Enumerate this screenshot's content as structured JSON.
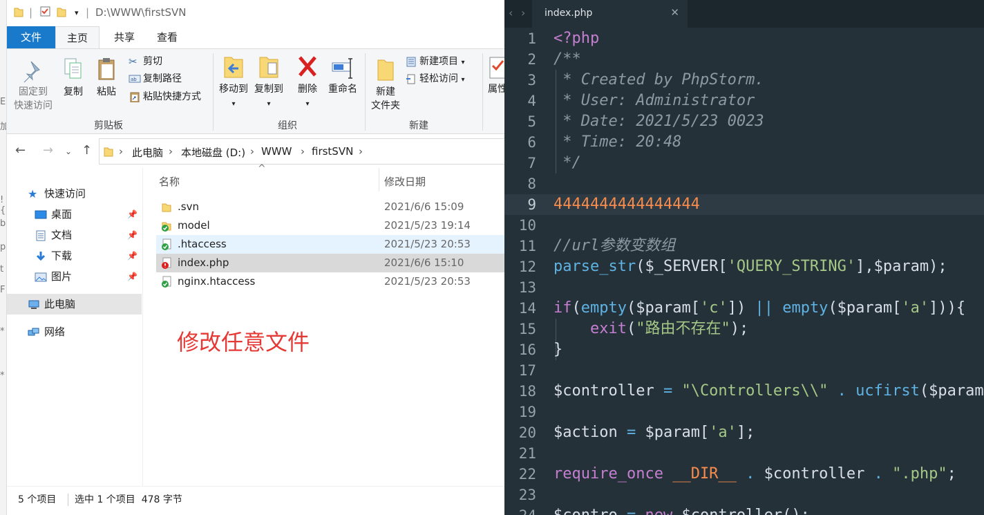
{
  "explorer": {
    "title_path": "D:\\WWW\\firstSVN",
    "tabs": [
      {
        "label": "文件"
      },
      {
        "label": "主页"
      },
      {
        "label": "共享"
      },
      {
        "label": "查看"
      }
    ],
    "ribbon": {
      "pin_line1": "固定到",
      "pin_line2": "快速访问",
      "copy": "复制",
      "paste": "粘贴",
      "cut": "剪切",
      "copy_path": "复制路径",
      "paste_shortcut": "粘贴快捷方式",
      "clipboard_group": "剪贴板",
      "move_to": "移动到",
      "copy_to": "复制到",
      "delete": "删除",
      "rename": "重命名",
      "organize_group": "组织",
      "new_folder_line1": "新建",
      "new_folder_line2": "文件夹",
      "new_item": "新建项目",
      "easy_access": "轻松访问",
      "new_group": "新建",
      "properties": "属性"
    },
    "breadcrumbs": [
      "此电脑",
      "本地磁盘 (D:)",
      "WWW",
      "firstSVN"
    ],
    "sidebar": {
      "quick_access": "快速访问",
      "items": [
        {
          "label": "桌面"
        },
        {
          "label": "文档"
        },
        {
          "label": "下载"
        },
        {
          "label": "图片"
        }
      ],
      "this_pc": "此电脑",
      "network": "网络"
    },
    "columns": {
      "name": "名称",
      "date": "修改日期"
    },
    "files": [
      {
        "name": ".svn",
        "date": "2021/6/6 15:09",
        "icon": "folder-icon"
      },
      {
        "name": "model",
        "date": "2021/5/23 19:14",
        "icon": "svn-normal-folder-icon"
      },
      {
        "name": ".htaccess",
        "date": "2021/5/23 20:53",
        "icon": "svn-normal-file-icon"
      },
      {
        "name": "index.php",
        "date": "2021/6/6 15:10",
        "icon": "svn-modified-file-icon"
      },
      {
        "name": "nginx.htaccess",
        "date": "2021/5/23 20:53",
        "icon": "svn-normal-file-icon"
      }
    ],
    "annotation": "修改任意文件",
    "status": {
      "count": "5 个项目",
      "selection": "选中 1 个项目  478 字节"
    },
    "colors": {
      "file_tab": "#1979ca",
      "annotation": "#e53935",
      "selected_row": "#d9d9d9",
      "hover_row": "#e5f3ff"
    }
  },
  "editor": {
    "tab_label": "index.php",
    "close_glyph": "✕",
    "current_line": "9",
    "line_numbers": [
      "1",
      "2",
      "3",
      "4",
      "5",
      "6",
      "7",
      "8",
      "9",
      "10",
      "11",
      "12",
      "13",
      "14",
      "15",
      "16",
      "17",
      "18",
      "19",
      "20",
      "21",
      "22",
      "23",
      "24"
    ],
    "code": {
      "l1": "<?php",
      "l2": "/**",
      "l3": " * Created by PhpStorm.",
      "l4": " * User: Administrator",
      "l5": " * Date: 2021/5/23 0023",
      "l6": " * Time: 20:48",
      "l7": " */",
      "l9": "4444444444444444",
      "l11": "//url参数变数组",
      "l12a": "parse_str",
      "l12b": "($_SERVER[",
      "l12c": "'QUERY_STRING'",
      "l12d": "],$param);",
      "l14a": "if",
      "l14b": "(",
      "l14c": "empty",
      "l14d": "($param[",
      "l14e": "'c'",
      "l14f": "]) ",
      "l14g": "||",
      "l14h": " ",
      "l14i": "empty",
      "l14j": "($param[",
      "l14k": "'a'",
      "l14l": "])){",
      "l15a": "    exit",
      "l15b": "(",
      "l15c": "\"路由不存在\"",
      "l15d": ");",
      "l16": "}",
      "l18a": "$controller ",
      "l18b": "=",
      "l18c": " \"\\Controllers\\\\\"",
      "l18d": " . ",
      "l18e": "ucfirst",
      "l18f": "($param",
      "l20a": "$action ",
      "l20b": "=",
      "l20c": " $param[",
      "l20d": "'a'",
      "l20e": "];",
      "l22a": "require_once",
      "l22b": " ",
      "l22c": "__DIR__",
      "l22d": " . ",
      "l22e": "$controller",
      "l22f": " . ",
      "l22g": "\".php\"",
      "l22h": ";",
      "l24a": "$contro",
      "l24b": " = ",
      "l24c": "new",
      "l24d": " $controller();"
    },
    "colors": {
      "background": "#253139",
      "comment": "#8b9aa3",
      "keyword": "#c57fd0",
      "function": "#5fb3e4",
      "string": "#a5c887",
      "number": "#f78c4c"
    }
  }
}
